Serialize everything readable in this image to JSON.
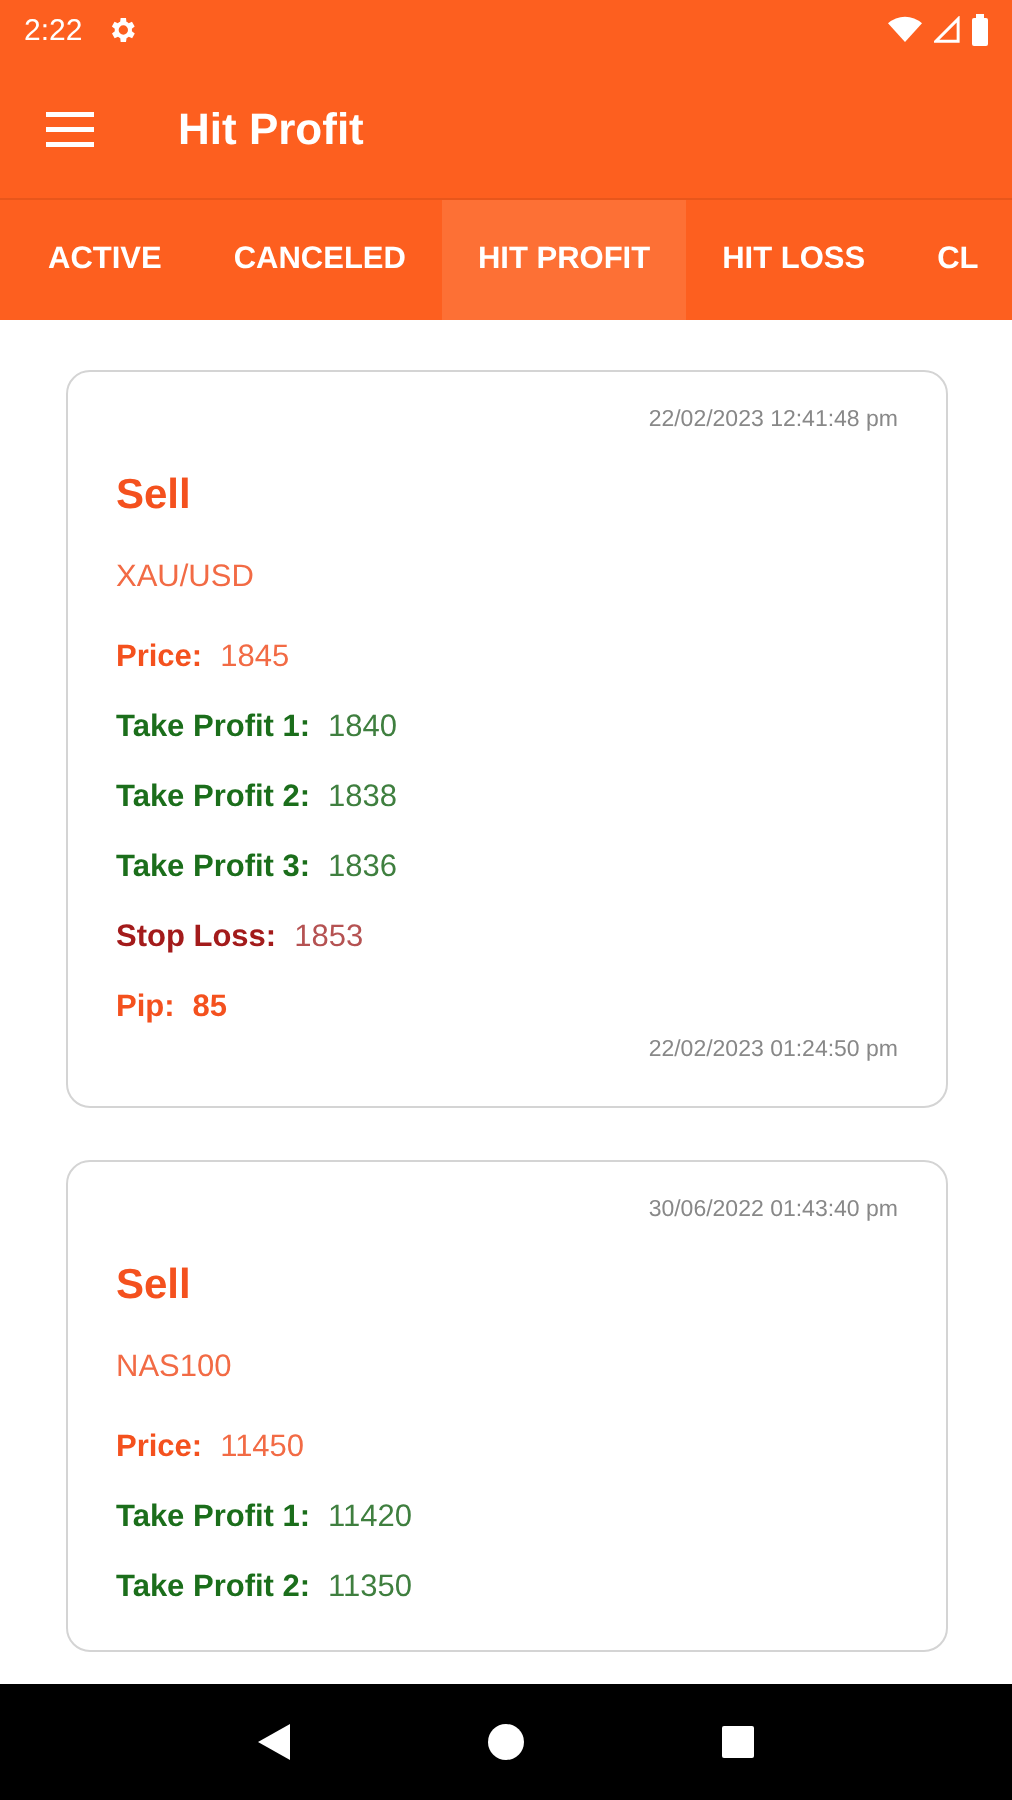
{
  "status_bar": {
    "time": "2:22"
  },
  "app_bar": {
    "title": "Hit Profit"
  },
  "tabs": [
    {
      "label": "ACTIVE",
      "selected": false
    },
    {
      "label": "CANCELED",
      "selected": false
    },
    {
      "label": "HIT PROFIT",
      "selected": true
    },
    {
      "label": "HIT LOSS",
      "selected": false
    },
    {
      "label": "CL",
      "selected": false
    }
  ],
  "signals": [
    {
      "opened": "22/02/2023 12:41:48 pm",
      "action": "Sell",
      "symbol": "XAU/USD",
      "fields": [
        {
          "kind": "price",
          "label": "Price:",
          "value": "1845"
        },
        {
          "kind": "take_profit",
          "label": "Take Profit 1:",
          "value": "1840"
        },
        {
          "kind": "take_profit",
          "label": "Take Profit 2:",
          "value": "1838"
        },
        {
          "kind": "take_profit",
          "label": "Take Profit 3:",
          "value": "1836"
        },
        {
          "kind": "stop_loss",
          "label": "Stop Loss:",
          "value": "1853"
        },
        {
          "kind": "pip",
          "label": "Pip:",
          "value": "85"
        }
      ],
      "closed": "22/02/2023 01:24:50 pm"
    },
    {
      "opened": "30/06/2022 01:43:40 pm",
      "action": "Sell",
      "symbol": "NAS100",
      "fields": [
        {
          "kind": "price",
          "label": "Price:",
          "value": "11450"
        },
        {
          "kind": "take_profit",
          "label": "Take Profit 1:",
          "value": "11420"
        },
        {
          "kind": "take_profit",
          "label": "Take Profit 2:",
          "value": "11350"
        }
      ]
    }
  ]
}
